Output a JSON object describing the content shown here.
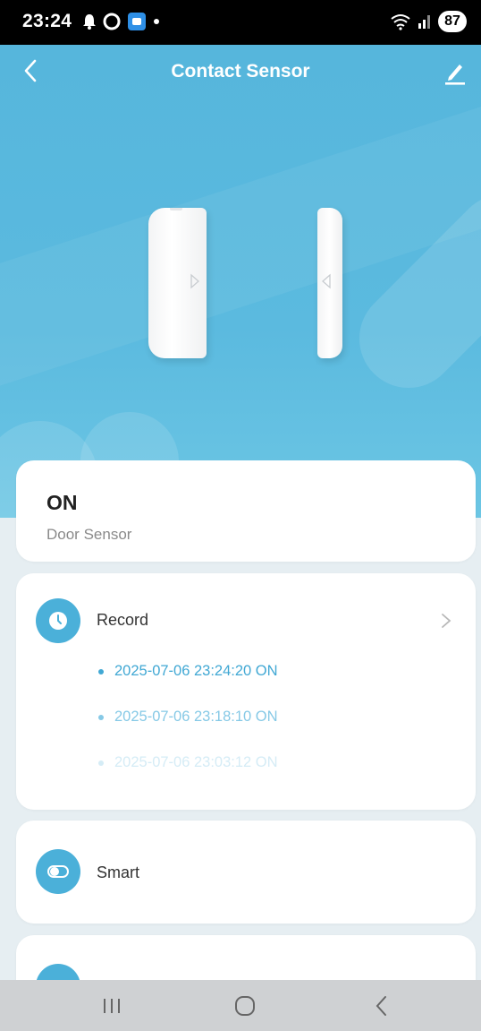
{
  "status_bar": {
    "time": "23:24",
    "battery": "87",
    "icons_left": [
      "bell-icon",
      "circle-icon",
      "app-icon",
      "dot-icon"
    ],
    "icons_right": [
      "wifi-icon",
      "signal-icon"
    ]
  },
  "header": {
    "title": "Contact Sensor",
    "back_icon": "back-arrow-icon",
    "edit_icon": "edit-pencil-icon"
  },
  "status_card": {
    "value": "ON",
    "label": "Door Sensor"
  },
  "record_card": {
    "label": "Record",
    "icon": "clock-icon",
    "entries": [
      "2025-07-06 23:24:20 ON",
      "2025-07-06 23:18:10 ON",
      "2025-07-06 23:03:12 ON"
    ]
  },
  "smart_card": {
    "label": "Smart",
    "icon": "toggle-icon"
  },
  "next_card": {
    "icon": "settings-icon"
  },
  "colors": {
    "accent": "#4bb0d9",
    "hero_bg": "#5bbadf",
    "card_bg": "#ffffff"
  },
  "system_nav": [
    "recents-icon",
    "home-icon",
    "back-icon"
  ]
}
